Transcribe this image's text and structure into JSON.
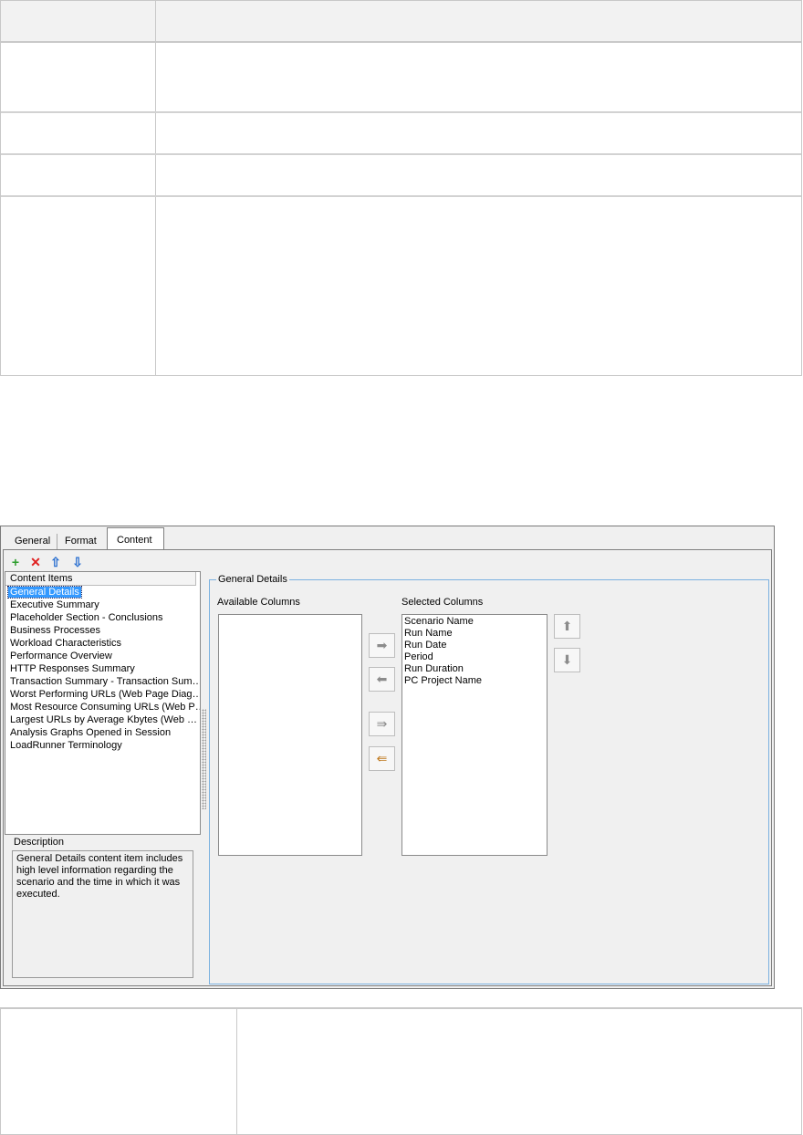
{
  "dialog": {
    "tabs": [
      {
        "label": "General"
      },
      {
        "label": "Format"
      },
      {
        "label": "Content"
      }
    ],
    "toolbar": {
      "add_icon": "plus-icon",
      "delete_icon": "red-x-icon",
      "up_icon": "arrow-up-icon",
      "down_icon": "arrow-down-icon"
    },
    "content_items": {
      "header": "Content Items",
      "items": [
        "General Details",
        "Executive Summary",
        "Placeholder Section - Conclusions",
        "Business Processes",
        "Workload Characteristics",
        "Performance Overview",
        "HTTP Responses Summary",
        "Transaction Summary - Transaction Sum…",
        "Worst Performing URLs (Web Page Diag…",
        "Most Resource Consuming URLs (Web P…",
        "Largest URLs by Average Kbytes (Web …",
        "Analysis Graphs Opened in Session",
        "LoadRunner Terminology"
      ],
      "selected_index": 0
    },
    "description": {
      "label": "Description",
      "text": "General Details content item includes high level information regarding the scenario and the time in which it was executed."
    },
    "details": {
      "group_title": "General Details",
      "available_label": "Available Columns",
      "selected_label": "Selected Columns",
      "selected_columns": [
        "Scenario Name",
        "Run Name",
        "Run Date",
        "Period",
        "Run Duration",
        "PC Project Name"
      ]
    },
    "colors": {
      "selection": "#3399ff",
      "group_border": "#7bb1e0",
      "add_icon": "#2e9e2e",
      "delete_icon": "#e02020",
      "arrow_icon": "#2a6fd0"
    }
  }
}
